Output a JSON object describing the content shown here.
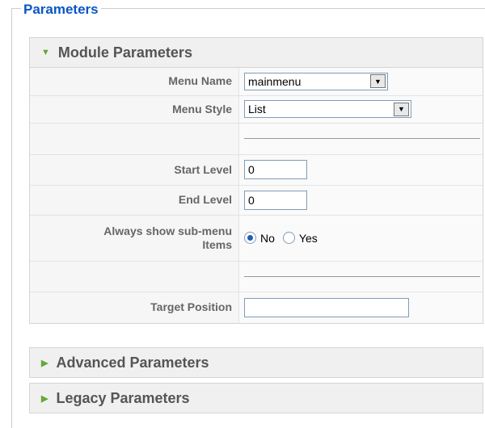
{
  "fieldset": {
    "legend": "Parameters"
  },
  "module_panel": {
    "title": "Module Parameters",
    "fields": {
      "menu_name": {
        "label": "Menu Name",
        "value": "mainmenu"
      },
      "menu_style": {
        "label": "Menu Style",
        "value": "List"
      },
      "start_level": {
        "label": "Start Level",
        "value": "0"
      },
      "end_level": {
        "label": "End Level",
        "value": "0"
      },
      "always_show": {
        "label_line1": "Always show sub-menu",
        "label_line2": "Items",
        "options": [
          "No",
          "Yes"
        ],
        "selected": "No"
      },
      "target_position": {
        "label": "Target Position",
        "value": ""
      }
    }
  },
  "advanced_panel": {
    "title": "Advanced Parameters"
  },
  "legacy_panel": {
    "title": "Legacy Parameters"
  },
  "colors": {
    "legend": "#0b55c4",
    "arrow": "#65a838"
  },
  "icons": {
    "expanded": "triangle-down-icon",
    "collapsed": "triangle-right-icon"
  }
}
